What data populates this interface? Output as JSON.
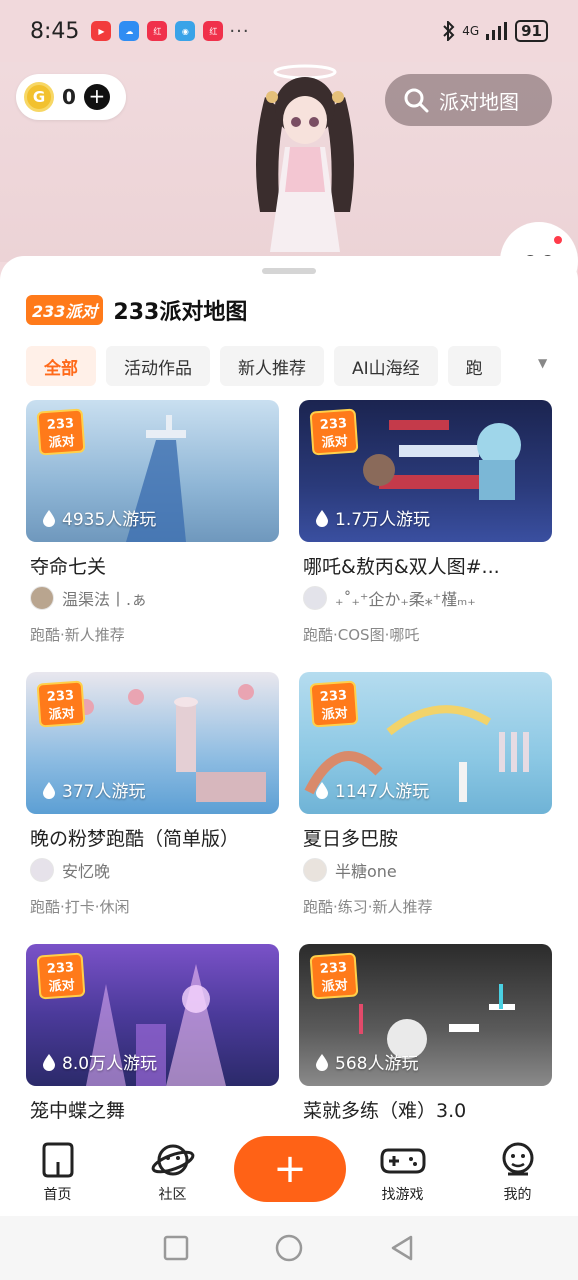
{
  "status_bar": {
    "time": "8:45",
    "network": "4G",
    "battery": "91"
  },
  "hero": {
    "coin_count": "0",
    "search_label": "派对地图"
  },
  "header": {
    "brand_tag": "233派对",
    "title": "233派对地图"
  },
  "tabs": [
    "全部",
    "活动作品",
    "新人推荐",
    "AI山海经",
    "跑"
  ],
  "badge_text": [
    "233",
    "派对"
  ],
  "cards": [
    {
      "plays": "4935人游玩",
      "title": "夺命七关",
      "author": "温渠法丨.ぁ",
      "tags": "跑酷·新人推荐"
    },
    {
      "plays": "1.7万人游玩",
      "title": "哪吒&敖丙&双人图#...",
      "author": "₊˚₊⁺企か₊柔⁎⁺槿ₘ₊",
      "tags": "跑酷·COS图·哪吒"
    },
    {
      "plays": "377人游玩",
      "title": "晚の粉梦跑酷（简单版）",
      "author": "安忆晚",
      "tags": "跑酷·打卡·休闲"
    },
    {
      "plays": "1147人游玩",
      "title": "夏日多巴胺",
      "author": "半糖one",
      "tags": "跑酷·练习·新人推荐"
    },
    {
      "plays": "8.0万人游玩",
      "title": "笼中蝶之舞",
      "author": "",
      "tags": ""
    },
    {
      "plays": "568人游玩",
      "title": "菜就多练（难）3.0",
      "author": "",
      "tags": ""
    }
  ],
  "bottom_nav": {
    "home": "首页",
    "community": "社区",
    "plus": "+",
    "find_games": "找游戏",
    "mine": "我的"
  },
  "colors": {
    "accent": "#ff6216",
    "tab_active_bg": "#fff0e8"
  }
}
